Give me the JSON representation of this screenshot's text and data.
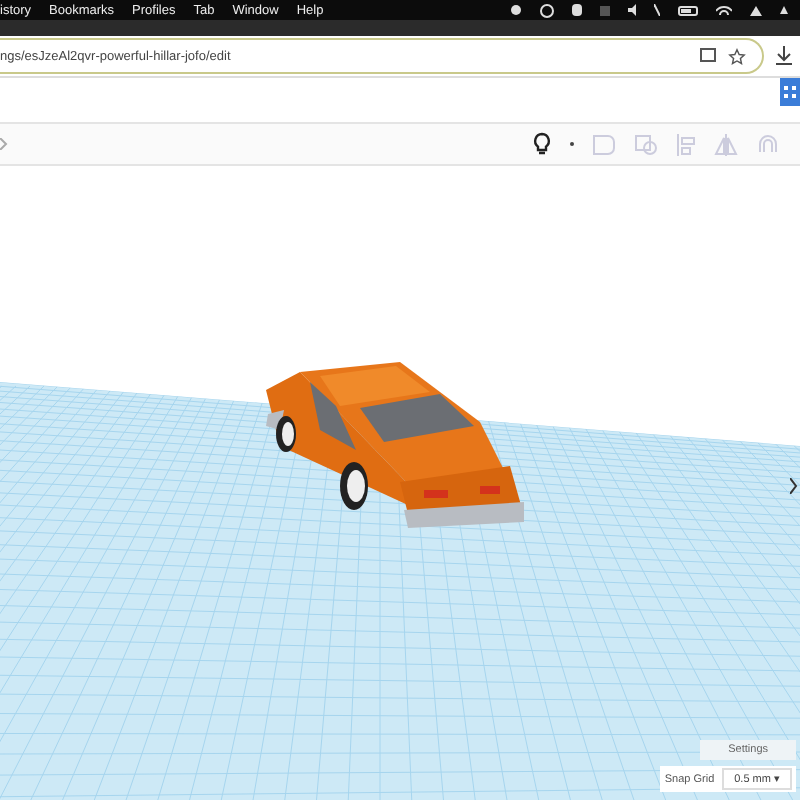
{
  "menu_bar": {
    "items": [
      "istory",
      "Bookmarks",
      "Profiles",
      "Tab",
      "Window",
      "Help"
    ]
  },
  "address_bar": {
    "url": "ngs/esJzeAl2qvr-powerful-hillar-jofo/edit"
  },
  "workplane": {
    "settings_button": "Settings",
    "snap_grid": {
      "label": "Snap Grid",
      "value": "0.5 mm ▾"
    }
  }
}
